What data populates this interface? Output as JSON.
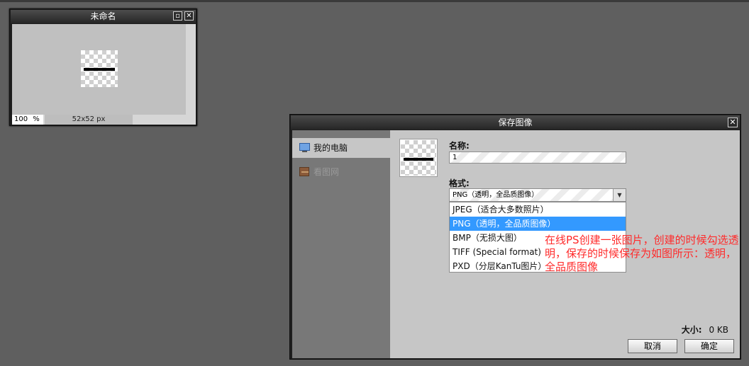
{
  "doc_window": {
    "title": "未命名",
    "zoom": "100",
    "zoom_unit": "%",
    "dimensions": "52x52 px",
    "buttons": {
      "maximize": "▫",
      "close": "✕"
    }
  },
  "save_dialog": {
    "title": "保存图像",
    "close": "✕",
    "locations": [
      {
        "label": "我的电脑",
        "icon": "computer-icon",
        "active": true
      },
      {
        "label": "看图网",
        "icon": "cabinet-icon",
        "active": false
      }
    ],
    "name_label": "名称:",
    "name_value": "1",
    "format_label": "格式:",
    "format_selected": "PNG（透明，全品质图像）",
    "format_options": [
      "JPEG（适合大多数照片）",
      "PNG（透明，全品质图像）",
      "BMP（无损大图）",
      "TIFF (Special format)",
      "PXD（分层KanTu图片）"
    ],
    "selected_index": 1,
    "annotation": "在线PS创建一张图片，创建的时候勾选透明，保存的时候保存为如图所示：透明，全品质图像",
    "size_label": "大小:",
    "size_value": "0 KB",
    "cancel_label": "取消",
    "ok_label": "确定"
  },
  "colors": {
    "selection": "#3399ff",
    "annotation": "#ff2a2a"
  }
}
